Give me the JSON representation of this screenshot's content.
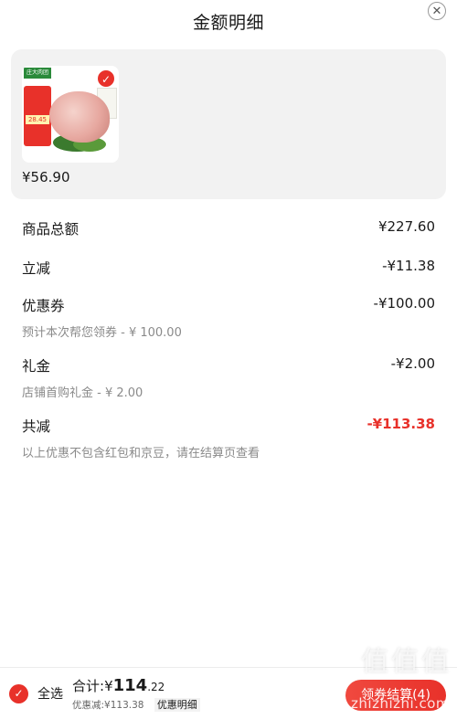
{
  "header": {
    "title": "金额明细",
    "close_glyph": "✕"
  },
  "product": {
    "image_alt": "pork-trotter-product-image",
    "brand_tag": "庄大肉团",
    "promo_price": "28.45",
    "selected_glyph": "✓",
    "price": "¥56.90"
  },
  "breakdown": {
    "goods_total": {
      "label": "商品总额",
      "amount": "¥227.60"
    },
    "instant_discount": {
      "label": "立减",
      "amount": "-¥11.38"
    },
    "coupon": {
      "label": "优惠券",
      "amount": "-¥100.00",
      "note": "预计本次帮您领券 - ¥ 100.00"
    },
    "gift_money": {
      "label": "礼金",
      "amount": "-¥2.00",
      "note": "店铺首购礼金 - ¥ 2.00"
    },
    "total_discount": {
      "label": "共减",
      "amount": "-¥113.38",
      "note": "以上优惠不包含红包和京豆，请在结算页查看"
    }
  },
  "bottom_bar": {
    "select_glyph": "✓",
    "select_all_label": "全选",
    "total_prefix": "合计:",
    "total_currency": "¥",
    "total_integer": "114",
    "total_decimal": ".22",
    "discount_text": "优惠减:¥113.38",
    "detail_link": "优惠明细",
    "checkout_label": "领券结算(4)"
  },
  "watermark": {
    "text": "值值值",
    "url": "zhizhizhi.com"
  },
  "colors": {
    "accent": "#e8312a",
    "card_bg": "#f2f2f2",
    "muted_text": "#8a8a8a"
  }
}
